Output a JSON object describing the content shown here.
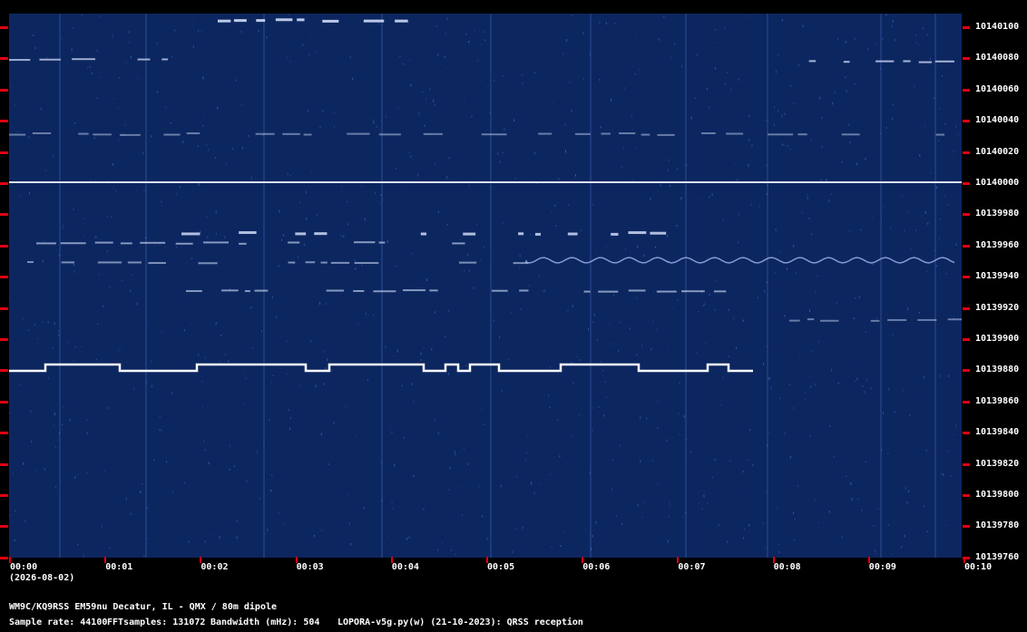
{
  "spectrogram": {
    "date": "(2026-08-02)",
    "freq_labels": [
      "10140100",
      "10140080",
      "10140060",
      "10140040",
      "10140020",
      "10140000",
      "10139980",
      "10139960",
      "10139940",
      "10139920",
      "10139900",
      "10139880",
      "10139860",
      "10139840",
      "10139820",
      "10139800",
      "10139780",
      "10139760"
    ],
    "time_labels": [
      "00:00",
      "00:01",
      "00:02",
      "00:03",
      "00:04",
      "00:05",
      "00:06",
      "00:07",
      "00:08",
      "00:09",
      "00:10"
    ],
    "colors": {
      "background": "#0c2660",
      "tick": "#e00010",
      "signal": "#ffffff"
    }
  },
  "footer": {
    "station": "WM9C/KQ9RSS EM59nu Decatur, IL - QMX / 80m dipole",
    "sample_rate": "Sample rate: 44100",
    "fft_samples": "FFTsamples: 131072",
    "bandwidth": "Bandwidth (mHz): 504",
    "software": "LOPORA-v5g.py(w) (21-10-2023): QRSS reception"
  }
}
